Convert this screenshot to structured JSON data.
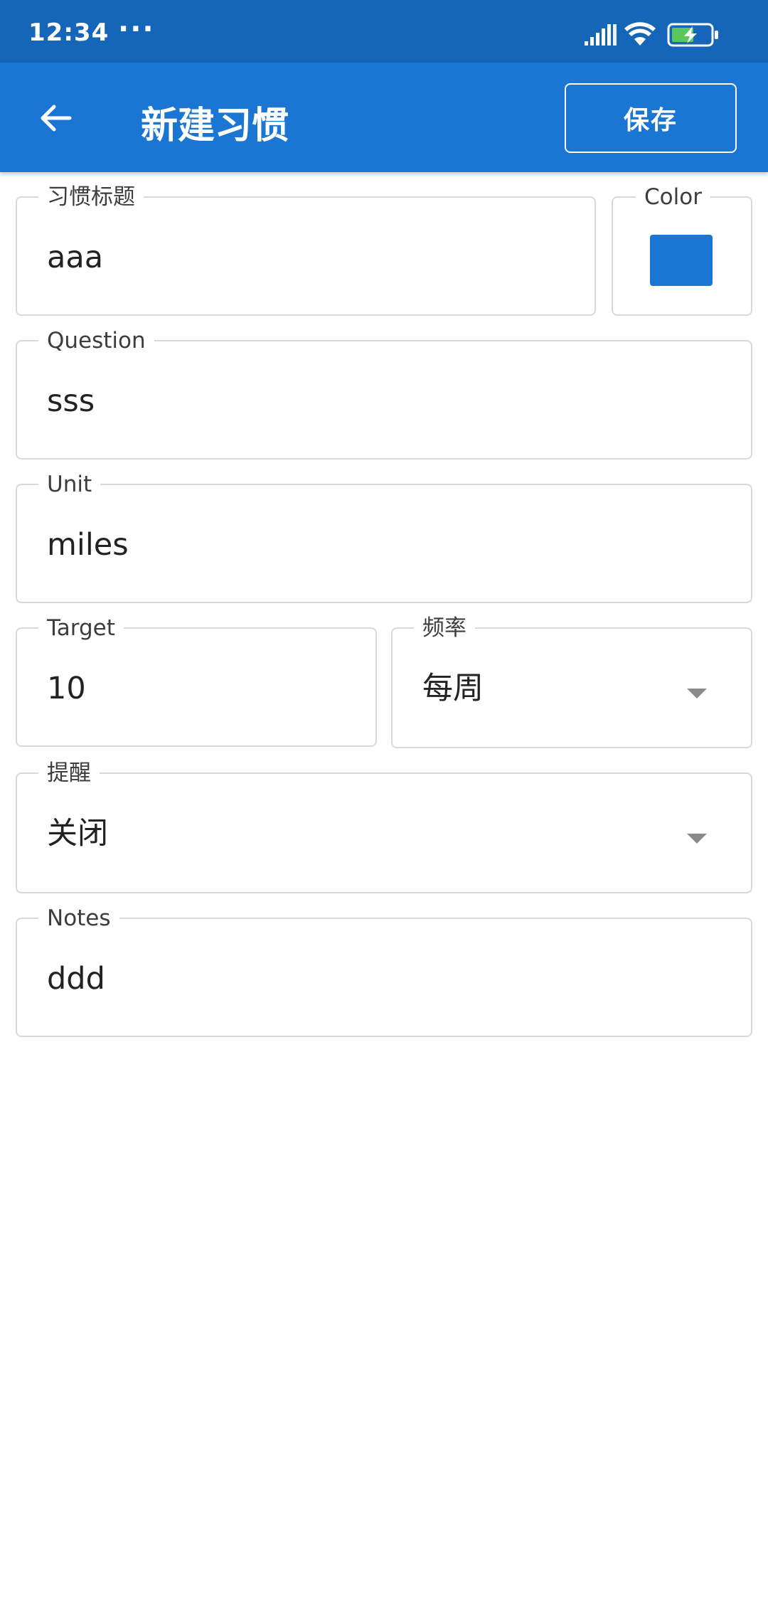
{
  "status_bar": {
    "time": "12:34",
    "dots": "···",
    "icons": [
      "signal-icon",
      "wifi-icon",
      "battery-charging-icon"
    ]
  },
  "app_bar": {
    "back_icon": "arrow-left-icon",
    "title": "新建习惯",
    "save_label": "保存"
  },
  "form": {
    "habit_title": {
      "label": "习惯标题",
      "value": "aaa"
    },
    "color": {
      "label": "Color",
      "value": "#1b76d3"
    },
    "question": {
      "label": "Question",
      "value": "sss"
    },
    "unit": {
      "label": "Unit",
      "value": "miles"
    },
    "target": {
      "label": "Target",
      "value": "10"
    },
    "frequency": {
      "label": "频率",
      "value": "每周"
    },
    "reminder": {
      "label": "提醒",
      "value": "关闭"
    },
    "notes": {
      "label": "Notes",
      "value": "ddd"
    }
  },
  "colors": {
    "status_bar": "#1565b8",
    "app_bar": "#1b76d3",
    "field_border": "#d8d8d8"
  }
}
